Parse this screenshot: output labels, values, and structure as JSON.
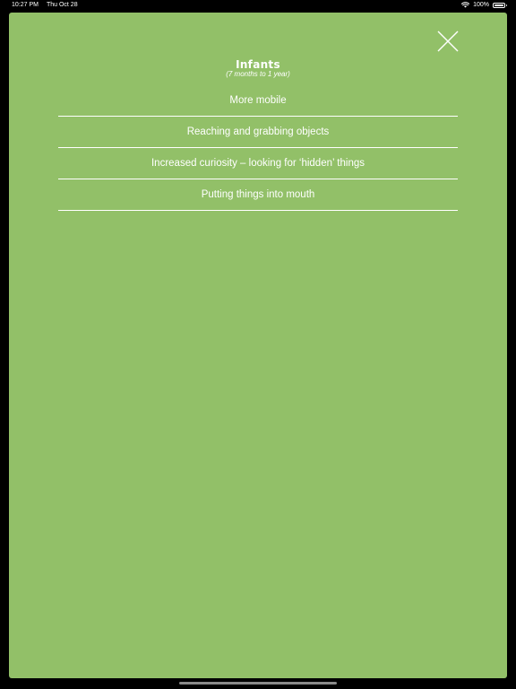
{
  "status_bar": {
    "time": "10:27 PM",
    "date": "Thu Oct 28",
    "battery_percent": "100%",
    "battery_level": 1.0,
    "icons": [
      "wifi-icon",
      "battery-icon"
    ]
  },
  "sheet": {
    "background_color": "#92c068",
    "title": "Infants",
    "subtitle": "(7 months to 1 year)",
    "close_icon": "close-icon",
    "items": [
      {
        "label": "More mobile"
      },
      {
        "label": "Reaching and grabbing objects"
      },
      {
        "label": "Increased curiosity – looking for ‘hidden’ things"
      },
      {
        "label": "Putting things into mouth"
      }
    ]
  }
}
